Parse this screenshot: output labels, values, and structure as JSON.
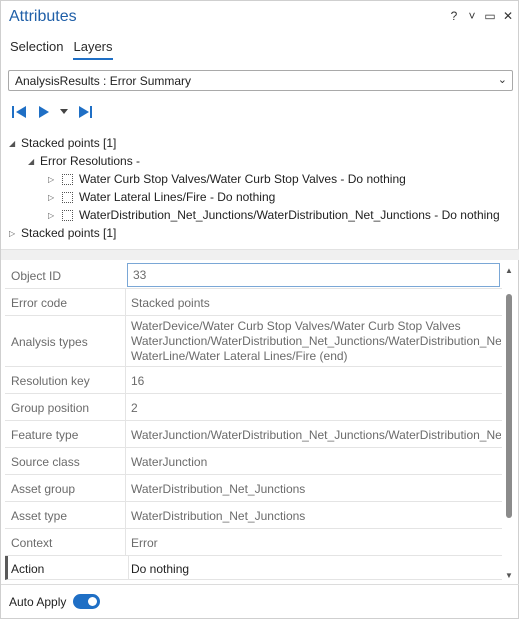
{
  "window": {
    "title": "Attributes",
    "controls": [
      "?",
      "˅",
      "▭",
      "✕"
    ]
  },
  "tabs": [
    {
      "label": "Selection",
      "active": false
    },
    {
      "label": "Layers",
      "active": true
    }
  ],
  "layer_dropdown": {
    "value": "AnalysisResults : Error Summary"
  },
  "navigation": {
    "icons": [
      "previous-icon",
      "next-icon",
      "dropdown-caret-icon",
      "last-icon"
    ]
  },
  "tree": {
    "root1": "Stacked points [1]",
    "group": "Error Resolutions -",
    "items": [
      "Water Curb Stop Valves/Water Curb Stop Valves - Do nothing",
      "Water Lateral Lines/Fire - Do nothing",
      "WaterDistribution_Net_Junctions/WaterDistribution_Net_Junctions - Do nothing"
    ],
    "root2": "Stacked points [1]"
  },
  "properties": [
    {
      "key": "Object ID",
      "value": "33"
    },
    {
      "key": "Error code",
      "value": "Stacked points"
    },
    {
      "key": "Analysis types",
      "lines": [
        "WaterDevice/Water Curb Stop Valves/Water Curb Stop Valves",
        "WaterJunction/WaterDistribution_Net_Junctions/WaterDistribution_Ne",
        "WaterLine/Water Lateral Lines/Fire (end)"
      ]
    },
    {
      "key": "Resolution key",
      "value": "16"
    },
    {
      "key": "Group position",
      "value": "2"
    },
    {
      "key": "Feature type",
      "value": "WaterJunction/WaterDistribution_Net_Junctions/WaterDistribution_Ne"
    },
    {
      "key": "Source class",
      "value": "WaterJunction"
    },
    {
      "key": "Asset group",
      "value": "WaterDistribution_Net_Junctions"
    },
    {
      "key": "Asset type",
      "value": "WaterDistribution_Net_Junctions"
    },
    {
      "key": "Context",
      "value": "Error"
    },
    {
      "key": "Action",
      "value": "Do nothing"
    }
  ],
  "footer": {
    "auto_apply_label": "Auto Apply",
    "auto_apply_on": true
  },
  "colors": {
    "accent": "#1f6fc5",
    "title": "#1f5fa8",
    "selection": "#cce3f7"
  }
}
